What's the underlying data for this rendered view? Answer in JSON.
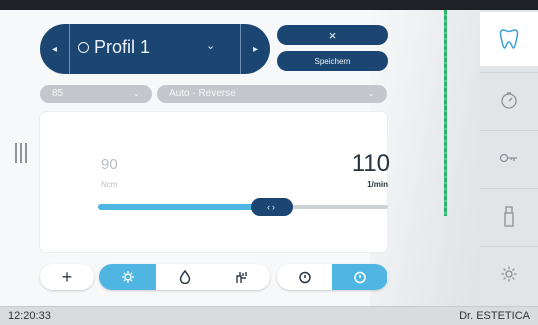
{
  "colors": {
    "navy": "#1b4672",
    "accent_blue": "#4fb6e3",
    "green_indicator": "#2fb36b",
    "background": "#f2f3f4"
  },
  "profile": {
    "name": "Profil 1",
    "prev_icon": "chevron-left-icon",
    "next_icon": "chevron-right-icon",
    "dropdown_icon": "chevron-down-icon"
  },
  "actions": {
    "close_label": "×",
    "save_label": "Speichern"
  },
  "selectors": {
    "first_value": "85",
    "second_value": "Auto - Reverse"
  },
  "speed": {
    "min_value": "90",
    "min_unit": "Ncm",
    "current_value": "110",
    "current_unit": "1/min",
    "fill_fraction": 0.6
  },
  "toolbar": {
    "plus_label": "+",
    "buttons": [
      {
        "icon": "light-icon",
        "active": true
      },
      {
        "icon": "water-drop-icon",
        "active": false
      },
      {
        "icon": "spray-icon",
        "active": false
      },
      {
        "icon": "timer-icon",
        "active": false
      },
      {
        "icon": "timer-icon",
        "active": true
      }
    ]
  },
  "sidebar": {
    "items": [
      "tooth-icon",
      "gauge-icon",
      "key-icon",
      "instrument-icon",
      "gear-icon"
    ],
    "active_index": 0
  },
  "status": {
    "time": "12:20:33",
    "user": "Dr. ESTETICA"
  }
}
